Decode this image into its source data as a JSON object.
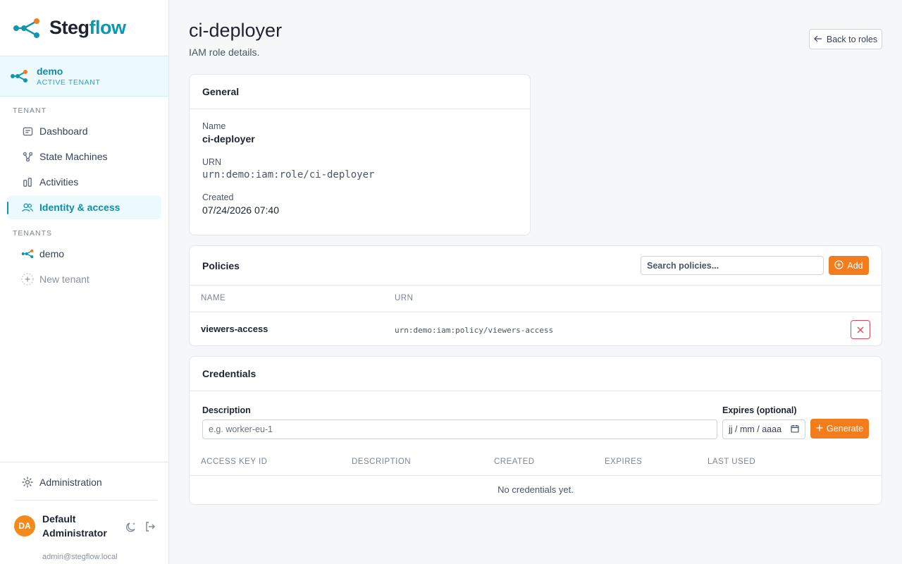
{
  "brand": {
    "name_part1": "Steg",
    "name_part2": "flow"
  },
  "active_tenant": {
    "name": "demo",
    "label": "ACTIVE TENANT"
  },
  "sidebar": {
    "section_tenant": "TENANT",
    "items": [
      {
        "label": "Dashboard",
        "icon": "dashboard-icon"
      },
      {
        "label": "State Machines",
        "icon": "state-machine-icon"
      },
      {
        "label": "Activities",
        "icon": "activities-icon"
      },
      {
        "label": "Identity & access",
        "icon": "users-icon",
        "active": true
      }
    ],
    "section_tenants": "TENANTS",
    "tenants": [
      {
        "label": "demo"
      }
    ],
    "new_tenant": "New tenant",
    "administration": "Administration"
  },
  "user": {
    "initials": "DA",
    "name": "Default Administrator",
    "email": "admin@stegflow.local"
  },
  "page": {
    "title": "ci-deployer",
    "subtitle": "IAM role details.",
    "back_label": "Back to roles"
  },
  "general": {
    "title": "General",
    "name_label": "Name",
    "name_value": "ci-deployer",
    "urn_label": "URN",
    "urn_value": "urn:demo:iam:role/ci-deployer",
    "created_label": "Created",
    "created_value": "07/24/2026 07:40"
  },
  "policies": {
    "title": "Policies",
    "search_placeholder": "Search policies...",
    "add_label": "Add",
    "columns": [
      "NAME",
      "URN"
    ],
    "rows": [
      {
        "name": "viewers-access",
        "urn": "urn:demo:iam:policy/viewers-access"
      }
    ]
  },
  "credentials": {
    "title": "Credentials",
    "description_label": "Description",
    "description_placeholder": "e.g. worker-eu-1",
    "expires_label": "Expires (optional)",
    "expires_placeholder": "jj / mm / aaaa",
    "generate_label": "Generate",
    "columns": [
      "ACCESS KEY ID",
      "DESCRIPTION",
      "CREATED",
      "EXPIRES",
      "LAST USED"
    ],
    "empty_text": "No credentials yet."
  },
  "colors": {
    "accent": "#0e98b0",
    "action": "#f37d1d",
    "danger": "#d9475a"
  }
}
